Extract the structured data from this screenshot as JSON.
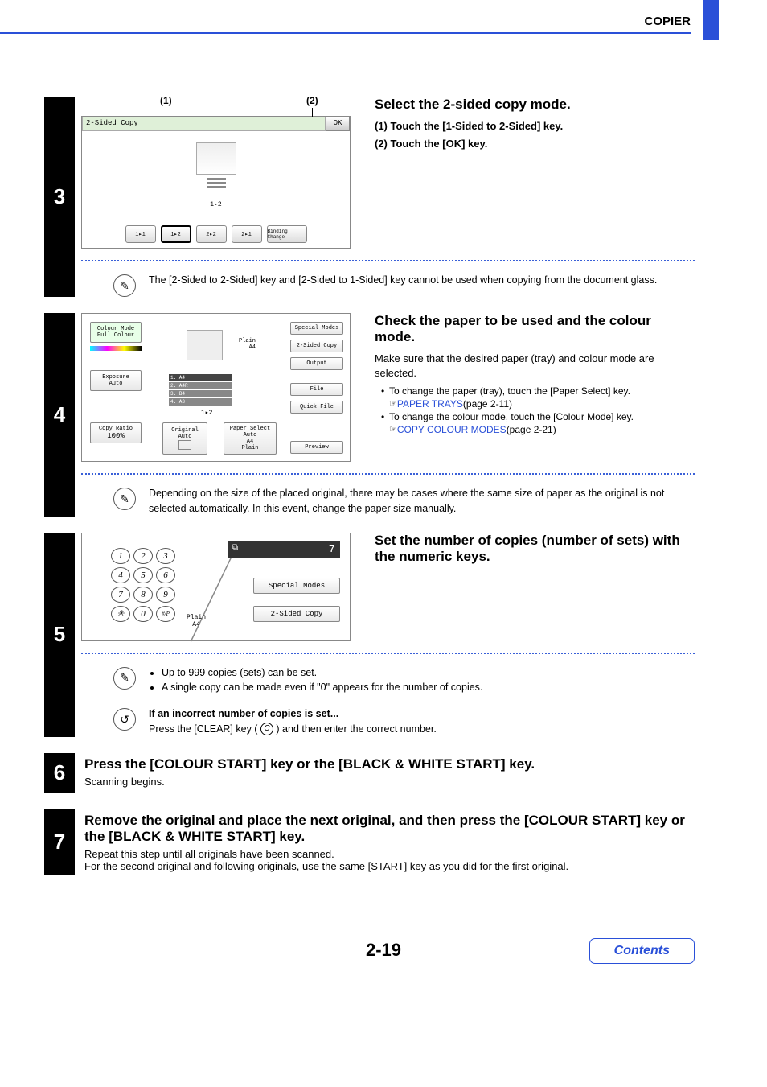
{
  "header": {
    "section": "COPIER"
  },
  "step3": {
    "num": "3",
    "callout1": "(1)",
    "callout2": "(2)",
    "panel": {
      "title": "2-Sided Copy",
      "ok": "OK",
      "mode_icon": "1▸2",
      "btn1": "1▸1",
      "btn2": "1▸2",
      "btn3": "2▸2",
      "btn4": "2▸1",
      "btn5": "Binding Change"
    },
    "heading": "Select the 2-sided copy mode.",
    "sub1": "(1)  Touch the [1-Sided to 2-Sided] key.",
    "sub2": "(2)  Touch the [OK] key.",
    "note": "The [2-Sided to 2-Sided] key and [2-Sided to 1-Sided] key cannot be used when copying from the document glass."
  },
  "step4": {
    "num": "4",
    "panel": {
      "colour_mode_lbl": "Colour Mode",
      "colour_mode_val": "Full Colour",
      "exposure_lbl": "Exposure",
      "exposure_val": "Auto",
      "copy_ratio_lbl": "Copy Ratio",
      "copy_ratio_val": "100%",
      "original_lbl": "Original",
      "original_val": "Auto",
      "paper_select_lbl": "Paper Select",
      "paper_select_val": "Auto\nA4\nPlain",
      "plain": "Plain",
      "a4": "A4",
      "tray1": "1.  A4",
      "tray2": "2.  A4R",
      "tray3": "3.  B4",
      "tray4": "4.  A3",
      "mode_icon": "1▸2",
      "special": "Special Modes",
      "twosided": "2-Sided Copy",
      "output": "Output",
      "file": "File",
      "quickfile": "Quick File",
      "preview": "Preview"
    },
    "heading": "Check the paper to be used and the colour mode.",
    "p1": "Make sure that the desired paper (tray) and colour mode are selected.",
    "b1": "To change the paper (tray), touch the [Paper Select] key.",
    "link1": "PAPER TRAYS",
    "link1_pg": " (page 2-11)",
    "b2": "To change the colour mode, touch the [Colour Mode] key.",
    "link2": "COPY COLOUR MODES",
    "link2_pg": " (page 2-21)",
    "note": "Depending on the size of the placed original, there may be cases where the same size of paper as the original is not selected automatically. In this event, change the paper size manually."
  },
  "step5": {
    "num": "5",
    "panel": {
      "display": "7",
      "keys": [
        "1",
        "2",
        "3",
        "4",
        "5",
        "6",
        "7",
        "8",
        "9",
        "✳",
        "0",
        "#/P"
      ],
      "plain": "Plain",
      "a4": "A4",
      "special": "Special Modes",
      "twosided": "2-Sided Copy"
    },
    "heading": "Set the number of copies (number of sets) with the numeric keys.",
    "note_bullets": [
      "Up to 999 copies (sets) can be set.",
      "A single copy can be made even if \"0\" appears for the number of copies."
    ],
    "tip_title": "If an incorrect number of copies is set...",
    "tip_body_a": "Press the [CLEAR] key ( ",
    "tip_key": "C",
    "tip_body_b": " ) and then enter the correct number."
  },
  "step6": {
    "num": "6",
    "heading": "Press the [COLOUR START] key or the [BLACK & WHITE START] key.",
    "body": "Scanning begins."
  },
  "step7": {
    "num": "7",
    "heading": "Remove the original and place the next original, and then press the [COLOUR START] key or the [BLACK & WHITE START] key.",
    "body1": "Repeat this step until all originals have been scanned.",
    "body2": "For the second original and following originals, use the same [START] key as you did for the first original."
  },
  "footer": {
    "page": "2-19",
    "contents": "Contents"
  }
}
